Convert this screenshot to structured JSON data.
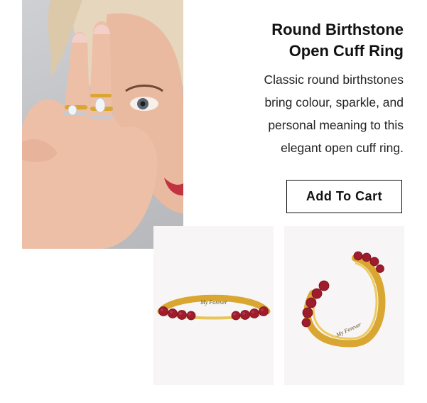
{
  "product": {
    "title_lines": [
      "Round Birthstone",
      "Open Cuff Ring"
    ],
    "description_lines": [
      "Classic round birthstones",
      "bring colour, sparkle, and",
      "personal meaning to this",
      "elegant open cuff ring."
    ],
    "add_to_cart_label": "Add To Cart"
  },
  "images": {
    "ring_engraving_front": "My Forever",
    "ring_engraving_side": "My Forever"
  },
  "colors": {
    "gold": "#d9a731",
    "gem": "#9e1c2c",
    "button_border": "#111111"
  },
  "icons": [
    "hero-model-photo",
    "ring-front-photo",
    "ring-side-photo"
  ]
}
